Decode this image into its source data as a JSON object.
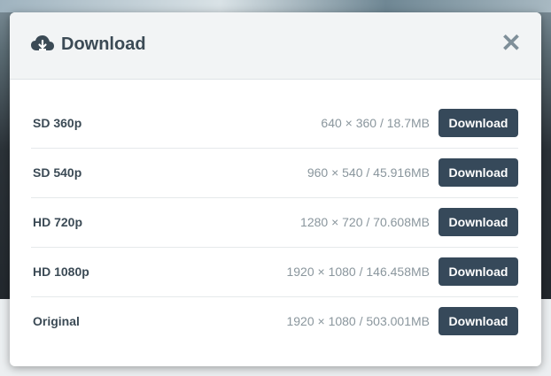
{
  "modal": {
    "title": "Download",
    "icon": "cloud-download-icon",
    "close_label": "✕",
    "colors": {
      "header_bg": "#f2f4f5",
      "button_bg": "#36495a",
      "title": "#3b4a55",
      "meta": "#8a969d"
    }
  },
  "rows": [
    {
      "quality": "SD 360p",
      "meta": "640 × 360 / 18.7MB",
      "button_label": "Download"
    },
    {
      "quality": "SD 540p",
      "meta": "960 × 540 / 45.916MB",
      "button_label": "Download"
    },
    {
      "quality": "HD 720p",
      "meta": "1280 × 720 / 70.608MB",
      "button_label": "Download"
    },
    {
      "quality": "HD 1080p",
      "meta": "1920 × 1080 / 146.458MB",
      "button_label": "Download"
    },
    {
      "quality": "Original",
      "meta": "1920 × 1080 / 503.001MB",
      "button_label": "Download"
    }
  ]
}
